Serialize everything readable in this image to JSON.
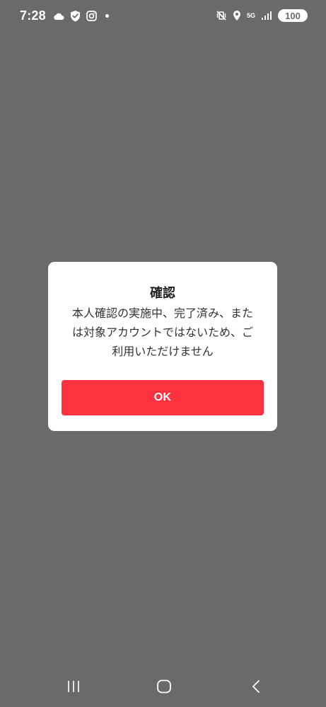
{
  "status_bar": {
    "time": "7:28",
    "network": "5G",
    "battery": "100",
    "left_icons": [
      "cloud-icon",
      "shield-check-icon",
      "instagram-icon",
      "notification-dot-icon"
    ],
    "right_icons": [
      "vibrate-mute-icon",
      "location-icon",
      "network-5g-icon",
      "signal-icon",
      "battery-icon"
    ]
  },
  "dialog": {
    "title": "確認",
    "message_lines": [
      "本人確認の実施中、完了済み、また",
      "は対象アカウントではないため、ご",
      "利用いただけません"
    ],
    "ok_label": "OK",
    "ok_color": "#ff333f"
  },
  "nav_bar": {
    "buttons": [
      "recent-apps-icon",
      "home-icon",
      "back-icon"
    ]
  },
  "colors": {
    "scrim": "#6a6a6a",
    "dialog_bg": "#ffffff",
    "accent": "#ff333f"
  }
}
